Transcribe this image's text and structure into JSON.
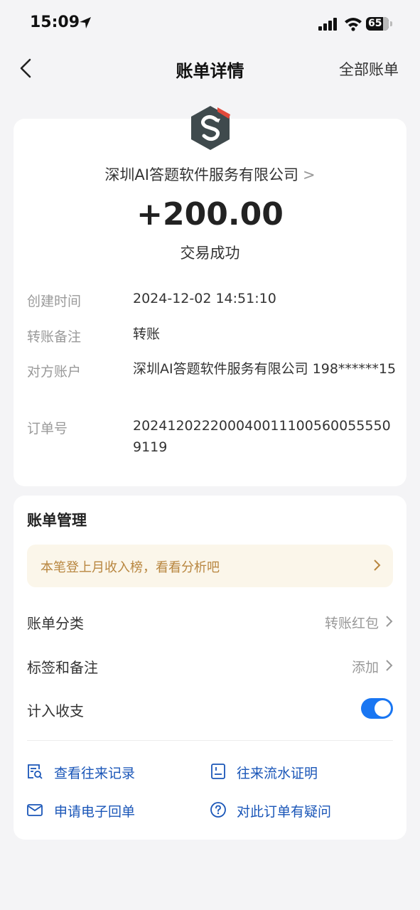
{
  "status_bar": {
    "time": "15:09",
    "battery": "65"
  },
  "nav": {
    "title": "账单详情",
    "right_link": "全部账单"
  },
  "transaction": {
    "merchant": "深圳AI答题软件服务有限公司",
    "amount": "+200.00",
    "status": "交易成功",
    "details": [
      {
        "label": "创建时间",
        "value": "2024-12-02 14:51:10"
      },
      {
        "label": "转账备注",
        "value": "转账"
      },
      {
        "label": "对方账户",
        "value": "深圳AI答题软件服务有限公司 198******15"
      },
      {
        "label": "订单号",
        "value": "2024120222000400111005600555509119"
      }
    ]
  },
  "management": {
    "title": "账单管理",
    "banner": "本笔登上月收入榜，看看分析吧",
    "category_label": "账单分类",
    "category_value": "转账红包",
    "tags_label": "标签和备注",
    "tags_value": "添加",
    "income_label": "计入收支",
    "income_enabled": true,
    "actions": {
      "history": "查看往来记录",
      "proof": "往来流水证明",
      "receipt": "申请电子回单",
      "question": "对此订单有疑问"
    }
  },
  "colors": {
    "accent": "#1976f2",
    "link": "#1a56b8",
    "banner_bg": "#fbf6ea",
    "banner_text": "#b8863f"
  }
}
